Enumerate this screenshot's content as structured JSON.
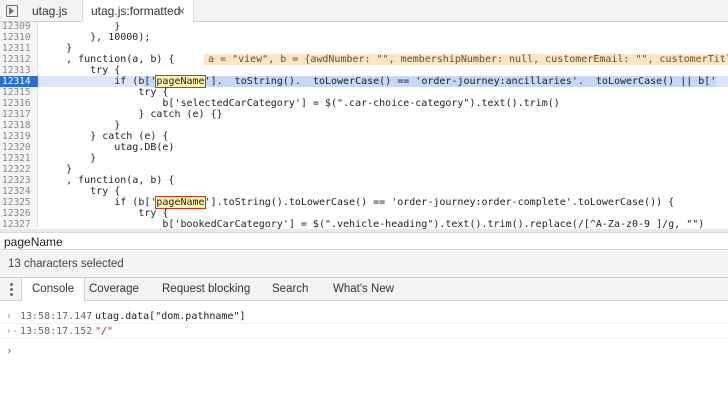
{
  "tabs": [
    {
      "label": "utag.js"
    },
    {
      "label": "utag.js:formatted",
      "close": "×"
    }
  ],
  "code_lines": [
    {
      "num": "12309",
      "text": "            }"
    },
    {
      "num": "12310",
      "text": "        }, 10000);"
    },
    {
      "num": "12311",
      "text": "    }"
    },
    {
      "num": "12312",
      "text": "    , function(a, b) {",
      "hint": "a = \"view\", b = {awdNumber: \"\", membershipNumber: null, customerEmail: \"\", customerTitle"
    },
    {
      "num": "12313",
      "text": "        try {"
    },
    {
      "num": "12314",
      "pre": "            if (b",
      "sel": "['",
      "find": "pageName",
      "post": "'].  toString().  toLowerCase() == 'order-journey:ancillaries'.  toLowerCase() || b['"
    },
    {
      "num": "12315",
      "text": "                try {"
    },
    {
      "num": "12316",
      "text": "                    b['selectedCarCategory'] = $(\".car-choice-category\").text().trim()"
    },
    {
      "num": "12317",
      "text": "                } catch (e) {}"
    },
    {
      "num": "12318",
      "text": "            }"
    },
    {
      "num": "12319",
      "text": "        } catch (e) {"
    },
    {
      "num": "12320",
      "text": "            utag.DB(e)"
    },
    {
      "num": "12321",
      "text": "        }"
    },
    {
      "num": "12322",
      "text": "    }"
    },
    {
      "num": "12323",
      "text": "    , function(a, b) {"
    },
    {
      "num": "12324",
      "text": "        try {"
    },
    {
      "num": "12325",
      "pre": "            if (b['",
      "find": "pageName",
      "post": "'].toString().toLowerCase() == 'order-journey:order-complete'.toLowerCase()) {"
    },
    {
      "num": "12326",
      "text": "                try {"
    },
    {
      "num": "12327",
      "text": "                    b['bookedCarCategory'] = $(\".vehicle-heading\").text().trim().replace(/[^A-Za-z0-9 ]/g, \"\")"
    }
  ],
  "search": {
    "query": "pageName"
  },
  "status": {
    "text": "13 characters selected"
  },
  "drawer_tabs": [
    {
      "label": "Console"
    },
    {
      "label": "Coverage"
    },
    {
      "label": "Request blocking"
    },
    {
      "label": "Search"
    },
    {
      "label": "What's New"
    }
  ],
  "console": {
    "entries": [
      {
        "arrow": "›",
        "time": "13:58:17.147",
        "expr": "utag.data[\"dom.pathname\"]"
      },
      {
        "arrow": "‹·",
        "time": "13:58:17.152",
        "result": "\"/\""
      }
    ],
    "prompt": "›"
  }
}
